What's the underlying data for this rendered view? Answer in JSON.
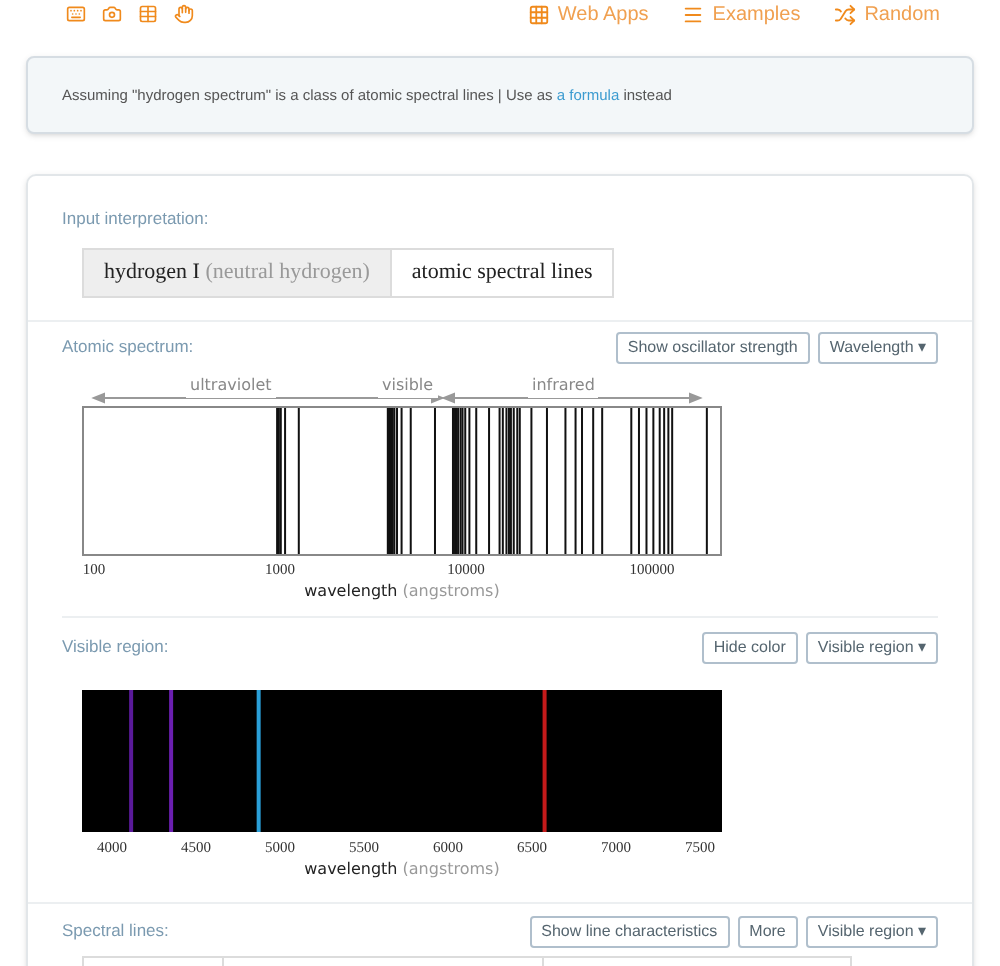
{
  "toolbar": {
    "nav": [
      {
        "kind": "apps",
        "label": "Web Apps"
      },
      {
        "kind": "examples",
        "label": "Examples"
      },
      {
        "kind": "random",
        "label": "Random"
      }
    ]
  },
  "assumption": {
    "before": "Assuming \"hydrogen spectrum\" is a class of atomic spectral lines | Use as ",
    "link": "a formula",
    "after": " instead"
  },
  "input_interpretation": {
    "title": "Input interpretation:",
    "cells": [
      {
        "main": "hydrogen I",
        "note": "(neutral hydrogen)",
        "shaded": true
      },
      {
        "main": "atomic spectral lines",
        "shaded": false
      }
    ]
  },
  "atomic_spectrum": {
    "title": "Atomic spectrum:",
    "buttons": [
      "Show oscillator strength",
      "Wavelength ▾"
    ],
    "regions": [
      "ultraviolet",
      "visible",
      "infrared"
    ],
    "xticks": [
      "100",
      "1000",
      "10000",
      "100000"
    ],
    "xlabel": "wavelength",
    "unit": "(angstroms)"
  },
  "visible_region": {
    "title": "Visible region:",
    "buttons": [
      "Hide color",
      "Visible region ▾"
    ],
    "xticks": [
      "4000",
      "4500",
      "5000",
      "5500",
      "6000",
      "6500",
      "7000",
      "7500"
    ],
    "xlabel": "wavelength",
    "unit": "(angstroms)"
  },
  "spectral_lines": {
    "title": "Spectral lines:",
    "buttons": [
      "Show line characteristics",
      "More",
      "Visible region ▾"
    ]
  }
}
